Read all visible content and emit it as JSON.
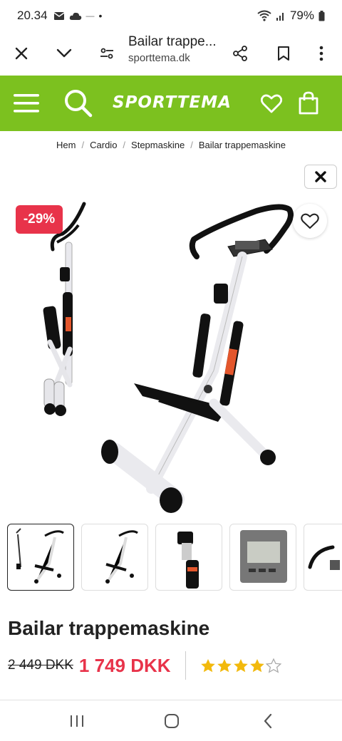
{
  "status_bar": {
    "time": "20.34",
    "battery": "79%",
    "dot": "•",
    "dash": "—",
    "icons": [
      "mail-icon",
      "cloud-icon",
      "wifi-icon",
      "signal-icon",
      "battery-icon"
    ]
  },
  "browser": {
    "page_title": "Bailar trappe...",
    "url": "sporttema.dk",
    "icons": [
      "close-icon",
      "chevron-down-icon",
      "tune-icon",
      "share-icon",
      "bookmark-icon",
      "more-icon"
    ]
  },
  "header": {
    "logo": "SPORTTEMA",
    "bg_color": "#7cc11f",
    "icons": [
      "menu-icon",
      "search-icon",
      "heart-icon",
      "bag-icon"
    ]
  },
  "breadcrumb": {
    "items": [
      "Hem",
      "Cardio",
      "Stepmaskine",
      "Bailar trappemaskine"
    ],
    "separator": "/"
  },
  "gallery": {
    "discount": "-29%",
    "discount_color": "#e8334a",
    "thumbnail_count": 5,
    "active_thumbnail": 1
  },
  "product": {
    "title": "Bailar trappemaskine",
    "old_price": "2 449 DKK",
    "new_price": "1 749 DKK",
    "rating": 4,
    "rating_max": 5
  },
  "nav": {
    "icons": [
      "recents-icon",
      "home-icon",
      "back-icon"
    ]
  }
}
